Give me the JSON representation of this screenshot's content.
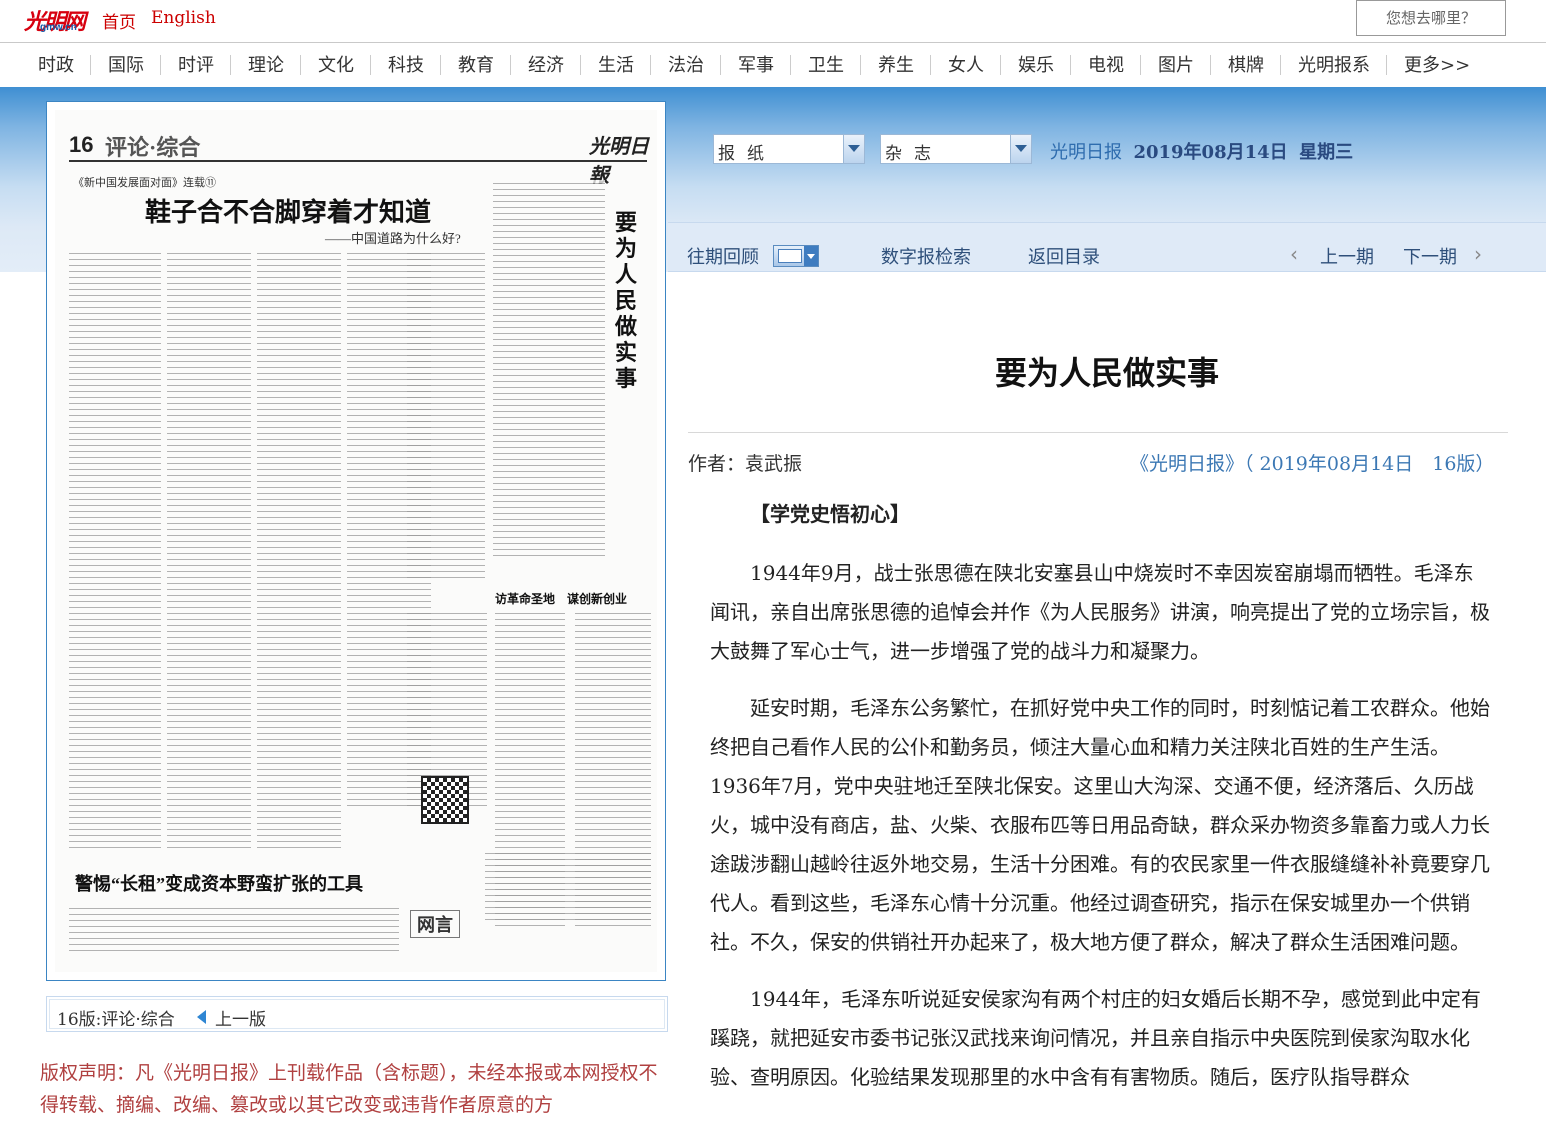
{
  "header": {
    "logo_text": "光明网",
    "logo_sub": "gmw.cn",
    "home": "首页",
    "english": "English",
    "search_placeholder": "您想去哪里？"
  },
  "nav": [
    "时政",
    "国际",
    "时评",
    "理论",
    "文化",
    "科技",
    "教育",
    "经济",
    "生活",
    "法治",
    "军事",
    "卫生",
    "养生",
    "女人",
    "娱乐",
    "电视",
    "图片",
    "棋牌",
    "光明报系",
    "更多>>"
  ],
  "selectors": {
    "paper": "报纸",
    "magazine": "杂志"
  },
  "date_line": {
    "name": "光明日报",
    "date": "2019年08月14日",
    "weekday": "星期三"
  },
  "subnav": {
    "past": "往期回顾",
    "search": "数字报检索",
    "back": "返回目录",
    "prev": "上一期",
    "next": "下一期"
  },
  "newspaper": {
    "page_num": "16",
    "section": "评论·综合",
    "masthead": "光明日報",
    "kicker": "《新中国发展面对面》连载⑪",
    "headline": "鞋子合不合脚穿着才知道",
    "headline_sub": "——中国道路为什么好?",
    "vertical_title": "要为人民做实事",
    "headline2": "警惕“长租”变成资本野蛮扩张的工具",
    "headline3": "访革命圣地　谋创新创业",
    "wangyan": "网言"
  },
  "caption": {
    "label": "16版:评论·综合",
    "prev": "上一版"
  },
  "copyright": "版权声明：凡《光明日报》上刊载作品（含标题），未经本报或本网授权不得转载、摘编、改编、篡改或以其它改变或违背作者原意的方",
  "article": {
    "title": "要为人民做实事",
    "author": "作者：袁武振",
    "source": "《光明日报》（ 2019年08月14日　16版）",
    "section_head": "【学党史悟初心】",
    "paragraphs": [
      "1944年9月，战士张思德在陕北安塞县山中烧炭时不幸因炭窑崩塌而牺牲。毛泽东闻讯，亲自出席张思德的追悼会并作《为人民服务》讲演，响亮提出了党的立场宗旨，极大鼓舞了军心士气，进一步增强了党的战斗力和凝聚力。",
      "延安时期，毛泽东公务繁忙，在抓好党中央工作的同时，时刻惦记着工农群众。他始终把自己看作人民的公仆和勤务员，倾注大量心血和精力关注陕北百姓的生产生活。1936年7月，党中央驻地迁至陕北保安。这里山大沟深、交通不便，经济落后、久历战火，城中没有商店，盐、火柴、衣服布匹等日用品奇缺，群众采办物资多靠畜力或人力长途跋涉翻山越岭往返外地交易，生活十分困难。有的农民家里一件衣服缝缝补补竟要穿几代人。看到这些，毛泽东心情十分沉重。他经过调查研究，指示在保安城里办一个供销社。不久，保安的供销社开办起来了，极大地方便了群众，解决了群众生活困难问题。",
      "1944年，毛泽东听说延安侯家沟有两个村庄的妇女婚后长期不孕，感觉到此中定有蹊跷，就把延安市委书记张汉武找来询问情况，并且亲自指示中央医院到侯家沟取水化验、查明原因。化验结果发现那里的水中含有有害物质。随后，医疗队指导群众"
    ]
  },
  "colors": {
    "brand_red": "#d7000f",
    "link_blue": "#3c78b4",
    "band_blue": "#3f8fd2"
  }
}
